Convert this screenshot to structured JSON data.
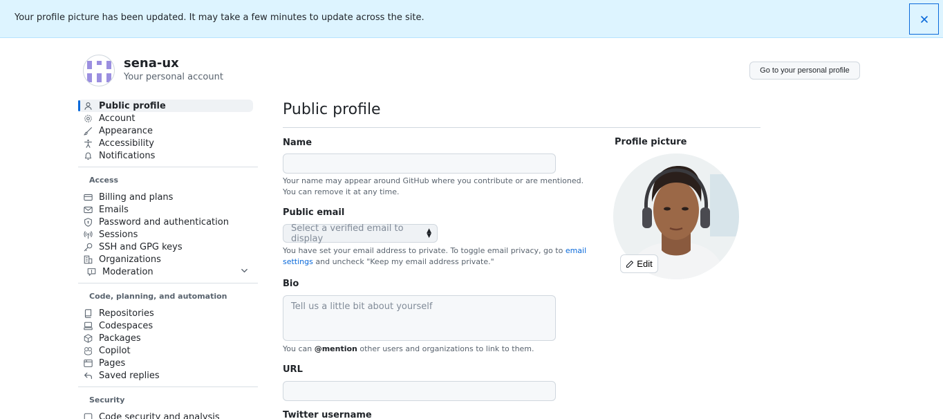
{
  "flash": {
    "message": "Your profile picture has been updated. It may take a few minutes to update across the site.",
    "close_icon": "close-icon"
  },
  "account": {
    "name": "sena-ux",
    "subtitle": "Your personal account",
    "profile_button": "Go to your personal profile"
  },
  "sidebar": {
    "items": [
      {
        "label": "Public profile",
        "icon": "person-icon"
      },
      {
        "label": "Account",
        "icon": "gear-icon"
      },
      {
        "label": "Appearance",
        "icon": "paintbrush-icon"
      },
      {
        "label": "Accessibility",
        "icon": "accessibility-icon"
      },
      {
        "label": "Notifications",
        "icon": "bell-icon"
      }
    ],
    "access_heading": "Access",
    "access_items": [
      {
        "label": "Billing and plans",
        "icon": "credit-card-icon"
      },
      {
        "label": "Emails",
        "icon": "mail-icon"
      },
      {
        "label": "Password and authentication",
        "icon": "shield-lock-icon"
      },
      {
        "label": "Sessions",
        "icon": "broadcast-icon"
      },
      {
        "label": "SSH and GPG keys",
        "icon": "key-icon"
      },
      {
        "label": "Organizations",
        "icon": "organization-icon"
      },
      {
        "label": "Moderation",
        "icon": "report-icon"
      }
    ],
    "code_heading": "Code, planning, and automation",
    "code_items": [
      {
        "label": "Repositories",
        "icon": "repo-icon"
      },
      {
        "label": "Codespaces",
        "icon": "codespaces-icon"
      },
      {
        "label": "Packages",
        "icon": "package-icon"
      },
      {
        "label": "Copilot",
        "icon": "copilot-icon"
      },
      {
        "label": "Pages",
        "icon": "browser-icon"
      },
      {
        "label": "Saved replies",
        "icon": "reply-icon"
      }
    ],
    "security_heading": "Security",
    "security_items": [
      {
        "label": "Code security and analysis",
        "icon": "codescan-icon"
      }
    ]
  },
  "main": {
    "title": "Public profile",
    "name_label": "Name",
    "name_value": "",
    "name_help": "Your name may appear around GitHub where you contribute or are mentioned. You can remove it at any time.",
    "email_label": "Public email",
    "email_select": "Select a verified email to display",
    "email_help_prefix": "You have set your email address to private. To toggle email privacy, go to ",
    "email_help_link": "email settings",
    "email_help_suffix": " and uncheck \"Keep my email address private.\"",
    "bio_label": "Bio",
    "bio_placeholder": "Tell us a little bit about yourself",
    "bio_help_prefix": "You can ",
    "bio_help_mention": "@mention",
    "bio_help_suffix": " other users and organizations to link to them.",
    "url_label": "URL",
    "url_value": "",
    "twitter_label": "Twitter username"
  },
  "picture": {
    "label": "Profile picture",
    "edit_label": "Edit"
  },
  "colors": {
    "accent": "#0969da",
    "flash_bg": "#ddf4ff"
  }
}
